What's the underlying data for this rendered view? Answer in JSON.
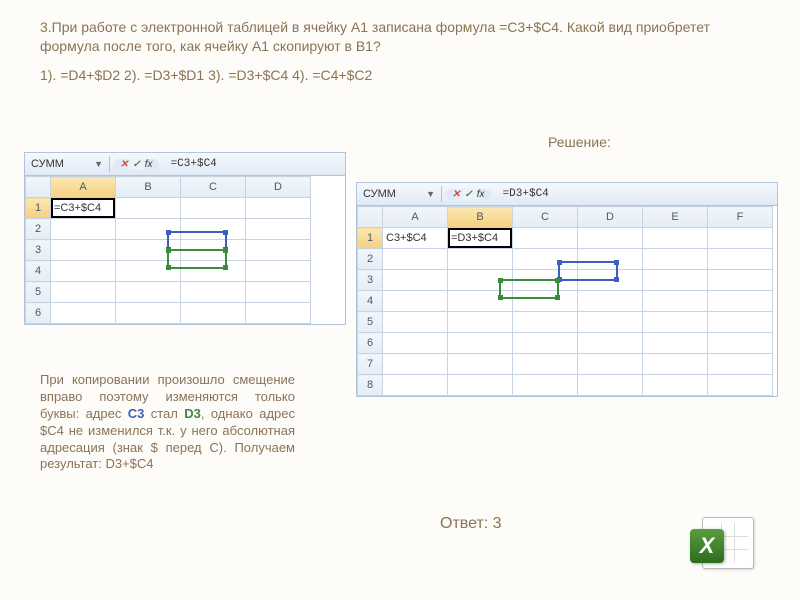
{
  "question": "3.При работе с электронной таблицей в ячейку A1 записана формула =C3+$C4. Какой вид приобретет формула после того, как  ячейку A1 скопируют в B1?",
  "options": "1). =D4+$D2    2). =D3+$D1    3). =D3+$C4    4). =C4+$C2",
  "label_solution": "Решение:",
  "excel1": {
    "name": "СУММ",
    "formula": "=C3+$C4",
    "cols": [
      "A",
      "B",
      "C",
      "D"
    ],
    "rows": [
      "1",
      "2",
      "3",
      "4",
      "5",
      "6"
    ],
    "a1": "=C3+$C4"
  },
  "excel2": {
    "name": "СУММ",
    "formula": "=D3+$C4",
    "cols": [
      "A",
      "B",
      "C",
      "D",
      "E",
      "F"
    ],
    "rows": [
      "1",
      "2",
      "3",
      "4",
      "5",
      "6",
      "7",
      "8"
    ],
    "a1": "C3+$C4",
    "b1": "=D3+$C4"
  },
  "explain_parts": {
    "p1": "При копировании произошло смещение вправо поэтому изменяются только буквы: адрес ",
    "c3": "C3",
    "p2": " стал ",
    "d3": "D3",
    "p3": ", однако адрес $C4 не изменился т.к. у него абсолютная адресация (знак $ перед C). Получаем результат: D3+$C4"
  },
  "answer": "Ответ: 3",
  "logo_letter": "X"
}
